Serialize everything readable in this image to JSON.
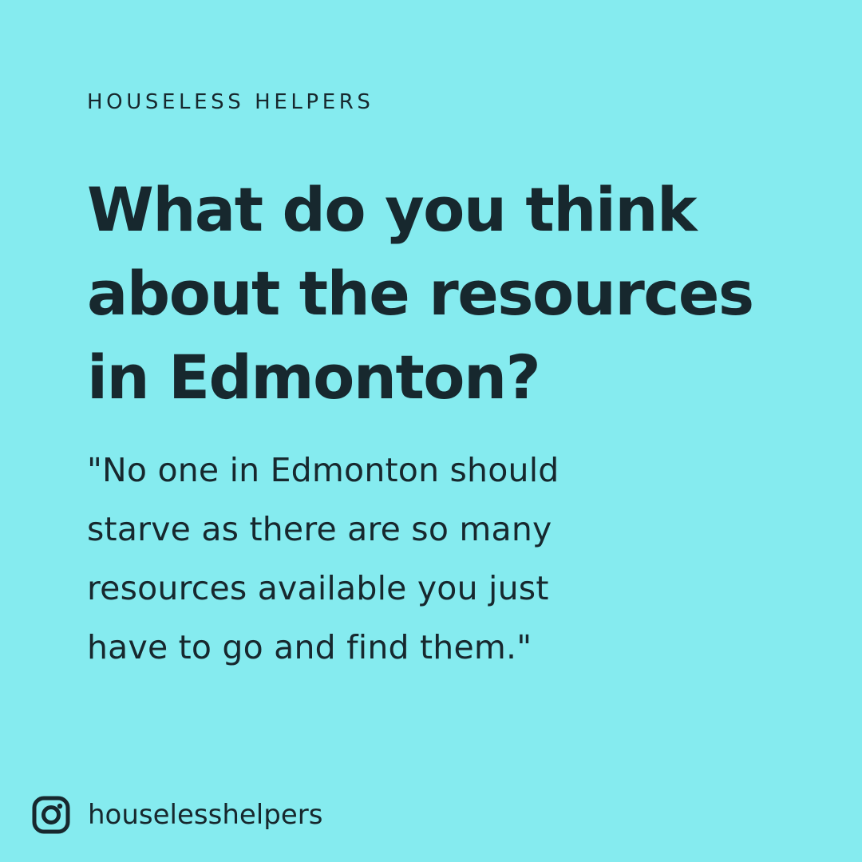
{
  "brand": "HOUSELESS HELPERS",
  "title_lines": [
    "What do you think",
    "about the resources",
    "in Edmonton?"
  ],
  "quote_lines": [
    "\"No one in Edmonton should",
    "starve as there are so many",
    "resources available you just",
    "have to go and find them.\""
  ],
  "footer": {
    "icon": "instagram-icon",
    "handle": "houselesshelpers"
  },
  "colors": {
    "background": "#85EBEF",
    "text": "#17282E"
  }
}
